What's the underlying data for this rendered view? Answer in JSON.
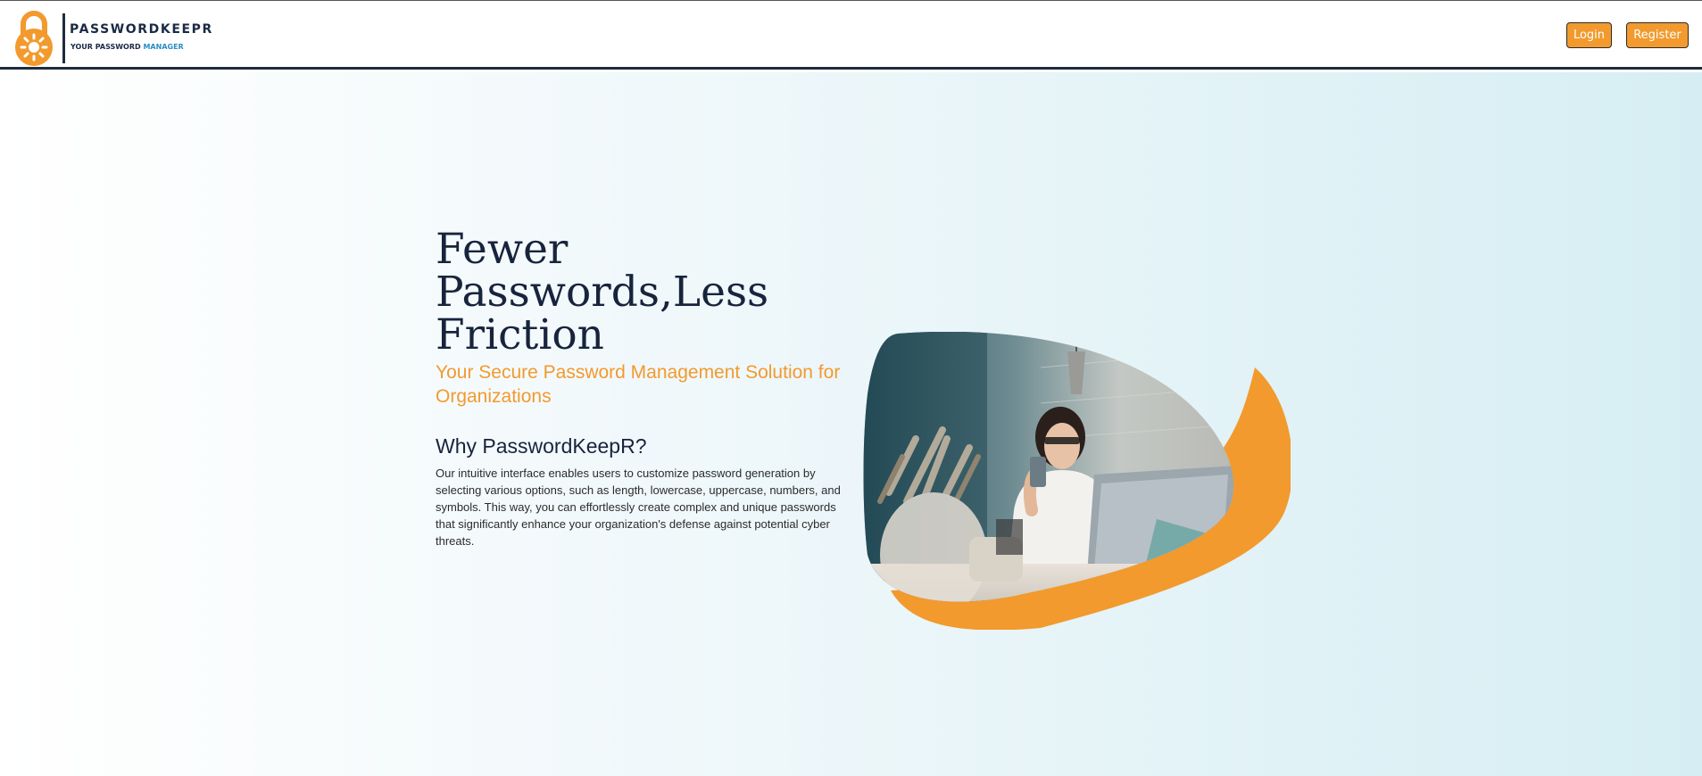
{
  "brand": {
    "name": "PASSWORDKEEPR",
    "tagline_part1": "YOUR PASSWORD",
    "tagline_part2": "MANAGER",
    "accent_color": "#f29a2e",
    "navy_color": "#1b2a44",
    "tagline_accent_color": "#2a8ec4"
  },
  "nav": {
    "login_label": "Login",
    "register_label": "Register"
  },
  "hero": {
    "title_line1": "Fewer",
    "title_line2": "Passwords,Less",
    "title_line3": "Friction",
    "subtitle": "Your Secure Password Management Solution for Organizations",
    "why_heading": "Why PasswordKeepR?",
    "why_body": "Our intuitive interface enables users to customize password generation by selecting various options, such as length, lowercase, uppercase, numbers, and symbols. This way, you can effortlessly create complex and unique passwords that significantly enhance your organization's defense against potential cyber threats."
  },
  "icons": {
    "logo": "padlock-icon",
    "hero_image": "woman-with-phone-and-laptop-photo"
  }
}
